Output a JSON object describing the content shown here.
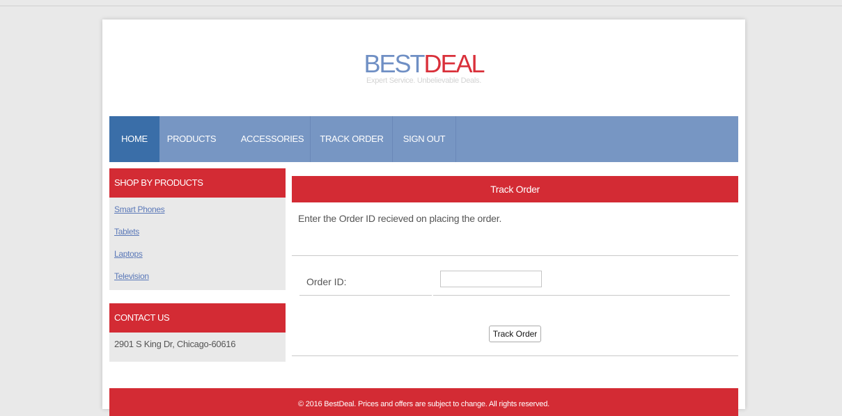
{
  "site": {
    "logo_part1": "BEST",
    "logo_part2": "DEAL",
    "tagline": "Expert Service. Unbelievable Deals."
  },
  "nav": {
    "items": [
      {
        "label": "HOME",
        "active": true
      },
      {
        "label": "PRODUCTS",
        "active": false
      },
      {
        "label": "ACCESSORIES",
        "active": false
      },
      {
        "label": "TRACK ORDER",
        "active": false
      },
      {
        "label": "SIGN OUT",
        "active": false
      }
    ]
  },
  "sidebar": {
    "shop_title": "SHOP BY PRODUCTS",
    "links": [
      "Smart Phones",
      "Tablets",
      "Laptops",
      "Television"
    ],
    "contact_title": "CONTACT US",
    "contact_address": "2901 S King Dr, Chicago-60616"
  },
  "main": {
    "title": "Track Order",
    "intro": "Enter the Order ID recieved on placing the order.",
    "order_id_label": "Order ID:",
    "order_id_value": "",
    "order_id_placeholder": "",
    "submit_label": "Track Order"
  },
  "footer": {
    "text": "© 2016 BestDeal. Prices and offers are subject to change. All rights reserved."
  },
  "colors": {
    "brand_blue": "#6f8fc4",
    "brand_red": "#d9303a",
    "nav_bg": "#7796c3",
    "nav_active": "#3a6ea8",
    "panel_red": "#d32b34"
  }
}
